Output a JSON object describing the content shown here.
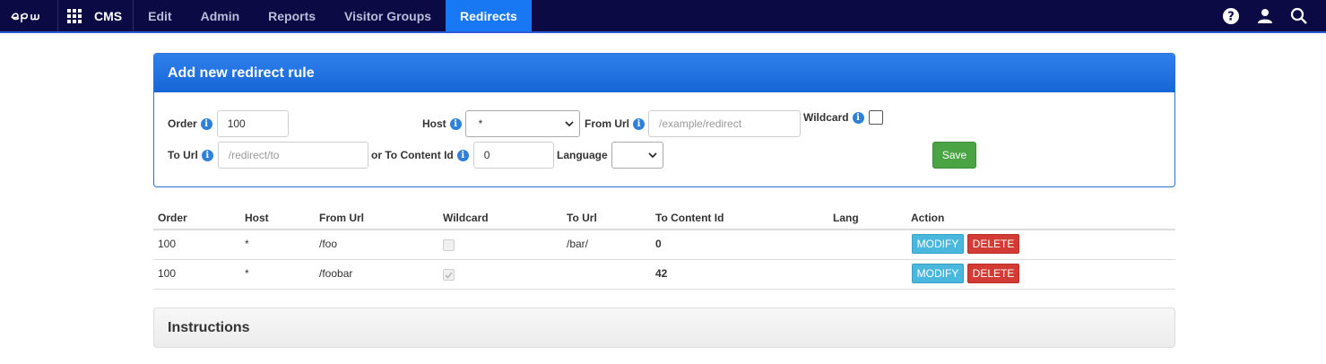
{
  "nav": {
    "brand": "CMS",
    "items": [
      {
        "label": "Edit"
      },
      {
        "label": "Admin"
      },
      {
        "label": "Reports"
      },
      {
        "label": "Visitor Groups"
      },
      {
        "label": "Redirects",
        "active": true
      }
    ],
    "right_icons": [
      "help-icon",
      "user-icon",
      "search-icon"
    ],
    "accent_color": "#1877f2",
    "bar_color": "#0b0a45"
  },
  "form": {
    "title": "Add new redirect rule",
    "order_label": "Order",
    "order_value": "100",
    "host_label": "Host",
    "host_value": "*",
    "from_url_label": "From Url",
    "from_url_placeholder": "/example/redirect",
    "wildcard_label": "Wildcard",
    "to_url_label": "To Url",
    "to_url_placeholder": "/redirect/to",
    "to_content_label": "or To Content Id",
    "to_content_value": "0",
    "language_label": "Language",
    "language_value": "",
    "save_label": "Save",
    "info_glyph": "i"
  },
  "table": {
    "headers": [
      "Order",
      "Host",
      "From Url",
      "Wildcard",
      "To Url",
      "To Content Id",
      "Lang",
      "Action"
    ],
    "rows": [
      {
        "order": "100",
        "host": "*",
        "from_url": "/foo",
        "wildcard": false,
        "to_url": "/bar/",
        "to_content_id": "0",
        "lang": ""
      },
      {
        "order": "100",
        "host": "*",
        "from_url": "/foobar",
        "wildcard": true,
        "to_url": "",
        "to_content_id": "42",
        "lang": ""
      }
    ],
    "modify_label": "MODIFY",
    "delete_label": "DELETE"
  },
  "instructions": {
    "title": "Instructions"
  }
}
